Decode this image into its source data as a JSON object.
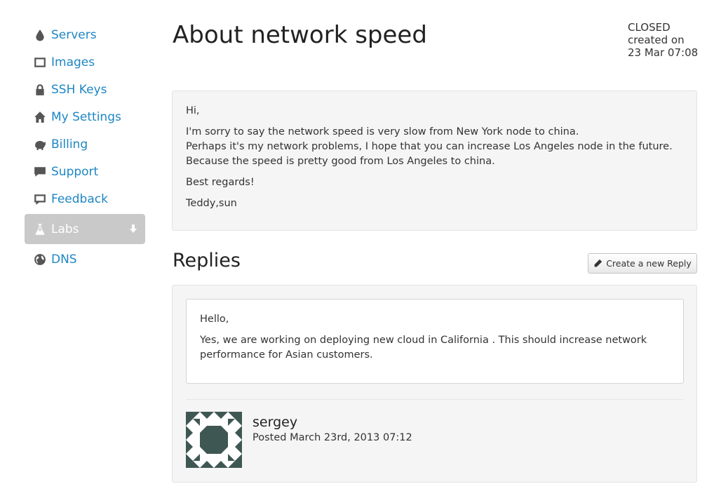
{
  "sidebar": {
    "items": [
      {
        "label": "Servers",
        "icon": "drop-icon"
      },
      {
        "label": "Images",
        "icon": "image-icon"
      },
      {
        "label": "SSH Keys",
        "icon": "lock-icon"
      },
      {
        "label": "My Settings",
        "icon": "home-icon"
      },
      {
        "label": "Billing",
        "icon": "piggy-bank-icon"
      },
      {
        "label": "Support",
        "icon": "chat-bubble-icon"
      },
      {
        "label": "Feedback",
        "icon": "comment-icon"
      },
      {
        "label": "Labs",
        "icon": "flask-icon",
        "active": true
      },
      {
        "label": "DNS",
        "icon": "globe-icon"
      }
    ]
  },
  "ticket": {
    "title": "About network speed",
    "status": "CLOSED",
    "created_label": "created on",
    "created_date": "23 Mar 07:08",
    "message": {
      "greeting": "Hi,",
      "line1": "I'm sorry to say the network speed is very slow from New York node to china.",
      "line2": "Perhaps it's my network problems, I hope that you can increase Los Angeles node in the future.",
      "line3": "Because the speed is pretty good from Los Angeles to china.",
      "closing": "Best regards!",
      "signature": "Teddy,sun"
    }
  },
  "replies": {
    "heading": "Replies",
    "create_button": "Create a new Reply",
    "items": [
      {
        "greeting": "Hello,",
        "body": "Yes, we are working on deploying new cloud in California . This should increase network performance for Asian customers.",
        "author": "sergey",
        "posted": "Posted March 23rd, 2013 07:12"
      }
    ]
  },
  "colors": {
    "link": "#1e86c4",
    "active_bg": "#c9c9c9",
    "avatar": "#3f5753"
  }
}
